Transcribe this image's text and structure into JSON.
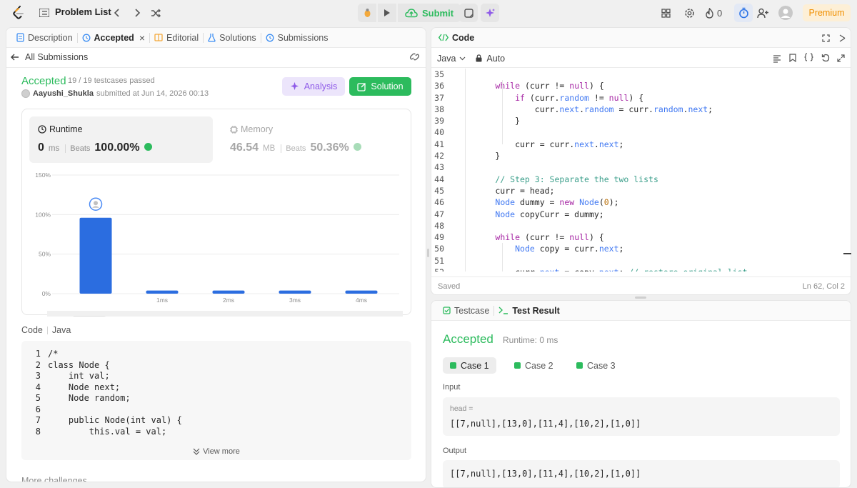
{
  "topbar": {
    "title": "Problem List",
    "submit_label": "Submit",
    "streak_count": "0",
    "premium_label": "Premium"
  },
  "left_tabs": [
    {
      "label": "Description"
    },
    {
      "label": "Accepted"
    },
    {
      "label": "Editorial"
    },
    {
      "label": "Solutions"
    },
    {
      "label": "Submissions"
    }
  ],
  "submission": {
    "back_label": "All Submissions",
    "status": "Accepted",
    "testcases": "19 / 19 testcases passed",
    "author": "Aayushi_Shukla",
    "submitted_text": "submitted at Jun 14, 2026 00:13",
    "analysis_label": "Analysis",
    "solution_label": "Solution"
  },
  "runtime": {
    "label": "Runtime",
    "value": "0",
    "unit": "ms",
    "beats_label": "Beats",
    "beats_value": "100.00%"
  },
  "memory": {
    "label": "Memory",
    "value": "46.54",
    "unit": "MB",
    "beats_label": "Beats",
    "beats_value": "50.36%"
  },
  "chart_data": {
    "type": "bar",
    "categories": [
      "0ms",
      "1ms",
      "2ms",
      "3ms",
      "4ms"
    ],
    "x_tick_labels": [
      "",
      "1ms",
      "2ms",
      "3ms",
      "4ms"
    ],
    "values": [
      96,
      4,
      4,
      4,
      4
    ],
    "ylim": [
      0,
      150
    ],
    "y_ticks": [
      "0%",
      "50%",
      "100%",
      "150%"
    ],
    "highlight_index": 0,
    "bar_color": "#2b6de0",
    "grid": true,
    "brush_ticks": [
      "1ms",
      "2ms",
      "3ms",
      "4ms"
    ]
  },
  "code_section": {
    "label": "Code",
    "language": "Java",
    "lines": [
      {
        "n": "1",
        "t": "/*"
      },
      {
        "n": "2",
        "t": "class Node {"
      },
      {
        "n": "3",
        "t": "    int val;"
      },
      {
        "n": "4",
        "t": "    Node next;"
      },
      {
        "n": "5",
        "t": "    Node random;"
      },
      {
        "n": "6",
        "t": ""
      },
      {
        "n": "7",
        "t": "    public Node(int val) {"
      },
      {
        "n": "8",
        "t": "        this.val = val;"
      }
    ],
    "view_more": "View more",
    "more_challenges": "More challenges"
  },
  "code_panel": {
    "title": "Code",
    "language": "Java",
    "mode": "Auto",
    "saved": "Saved",
    "cursor": "Ln 62, Col 2"
  },
  "editor_lines": [
    {
      "n": "35",
      "t": ""
    },
    {
      "n": "36",
      "t": "        while (curr != null) {"
    },
    {
      "n": "37",
      "t": "            if (curr.random != null) {"
    },
    {
      "n": "38",
      "t": "                curr.next.random = curr.random.next;"
    },
    {
      "n": "39",
      "t": "            }"
    },
    {
      "n": "40",
      "t": ""
    },
    {
      "n": "41",
      "t": "            curr = curr.next.next;"
    },
    {
      "n": "42",
      "t": "        }"
    },
    {
      "n": "43",
      "t": ""
    },
    {
      "n": "44",
      "t": "        // Step 3: Separate the two lists"
    },
    {
      "n": "45",
      "t": "        curr = head;"
    },
    {
      "n": "46",
      "t": "        Node dummy = new Node(0);"
    },
    {
      "n": "47",
      "t": "        Node copyCurr = dummy;"
    },
    {
      "n": "48",
      "t": ""
    },
    {
      "n": "49",
      "t": "        while (curr != null) {"
    },
    {
      "n": "50",
      "t": "            Node copy = curr.next;"
    },
    {
      "n": "51",
      "t": ""
    },
    {
      "n": "52",
      "t": "            curr.next = copy.next; // restore original list"
    }
  ],
  "test_panel": {
    "tab_testcase": "Testcase",
    "tab_result": "Test Result",
    "status": "Accepted",
    "runtime": "Runtime: 0 ms",
    "cases": [
      "Case 1",
      "Case 2",
      "Case 3"
    ],
    "input_label": "Input",
    "input_var": "head =",
    "input_value": "[[7,null],[13,0],[11,4],[10,2],[1,0]]",
    "output_label": "Output",
    "output_value": "[[7,null],[13,0],[11,4],[10,2],[1,0]]"
  }
}
